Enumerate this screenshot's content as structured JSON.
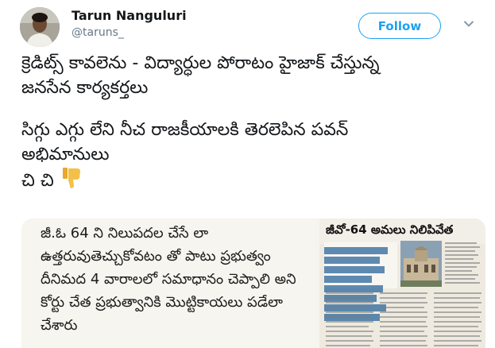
{
  "user": {
    "name": "Tarun Nanguluri",
    "handle": "@taruns_"
  },
  "follow_label": "Follow",
  "tweet": {
    "lines": [
      "క్రెడిట్స్ కావలెను - విద్యార్ధుల పోరాటం హైజాక్ చేస్తున్న",
      "జనసేన కార్యకర్తలు",
      "సిగ్గు ఎగ్గు లేని నీచ రాజకీయాలకి తెరలెపిన పవన్",
      "అభిమానులు",
      "చి చి"
    ]
  },
  "media": {
    "left_lines": [
      "జీ.ఓ 64 ని నిలుపదల చేసే లా",
      "ఉత్తరువుతెచ్చుకోవటం తో పాటు ప్రభుత్వం",
      "దీనిమద 4 వారాలలో సమాధానం చెప్పాలి అని",
      "కోర్టు చేత ప్రభుత్వానికి మొట్టికాయలు పడేలా",
      "చేశారు"
    ],
    "news_headline": "జీవో-64 అమలు నిలిపివేత"
  },
  "colors": {
    "accent": "#1da1f2",
    "text": "#14171a",
    "muted": "#657786",
    "thumb": "#f5c04a"
  }
}
